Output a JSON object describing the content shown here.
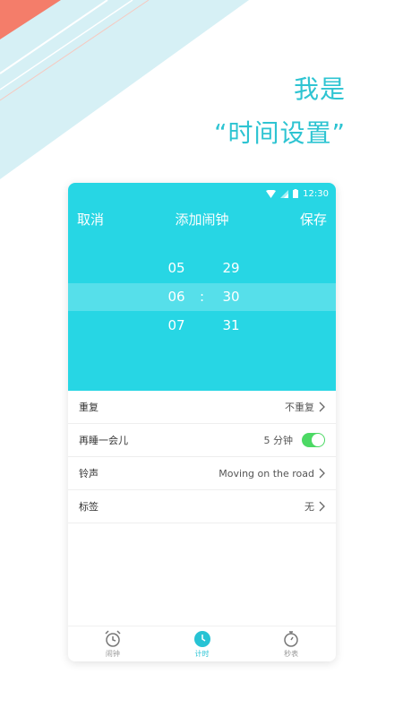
{
  "headline": {
    "line1": "我是",
    "line2": "“时间设置”"
  },
  "statusbar": {
    "time": "12:30"
  },
  "navbar": {
    "cancel": "取消",
    "title": "添加闹钟",
    "save": "保存"
  },
  "picker": {
    "hours": [
      "05",
      "06",
      "07"
    ],
    "minutes": [
      "29",
      "30",
      "31"
    ],
    "separator": ":"
  },
  "settings": [
    {
      "label": "重复",
      "value": "不重复"
    },
    {
      "label": "再睡一会儿",
      "value": "5 分钟",
      "toggle": true
    },
    {
      "label": "铃声",
      "value": "Moving on the road"
    },
    {
      "label": "标签",
      "value": "无"
    }
  ],
  "tabs": [
    {
      "label": "闹钟",
      "icon": "alarm-clock-icon"
    },
    {
      "label": "计时",
      "icon": "timer-clock-icon",
      "active": true
    },
    {
      "label": "秒表",
      "icon": "stopwatch-icon"
    }
  ],
  "colors": {
    "accent": "#27d6e4",
    "headline": "#2ec4d2",
    "toggle_on": "#4cd964",
    "deco_salmon": "#f47d6a",
    "deco_lightblue": "#cfeef4"
  }
}
